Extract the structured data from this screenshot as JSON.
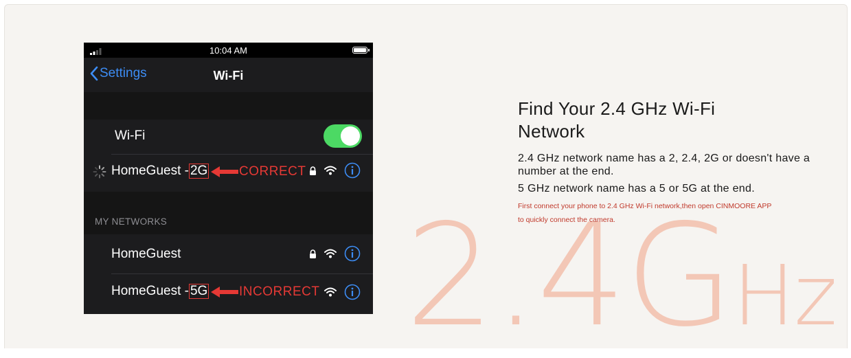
{
  "watermark": {
    "main": "2.4G",
    "unit": "Hz",
    "color": "#f3c7b6"
  },
  "phone": {
    "status": {
      "time": "10:04 AM"
    },
    "nav": {
      "back_label": "Settings",
      "title": "Wi-Fi"
    },
    "wifi_row": {
      "label": "Wi-Fi",
      "toggle_on": true
    },
    "current_network": {
      "name_prefix": "HomeGuest -",
      "name_suffix": "2G",
      "flag": "CORRECT"
    },
    "section_header": "MY NETWORKS",
    "networks": [
      {
        "name": "HomeGuest"
      },
      {
        "name_prefix": "HomeGuest -",
        "name_suffix": "5G",
        "flag": "INCORRECT"
      }
    ],
    "colors": {
      "accent": "#3d8df5",
      "toggle": "#4cd964",
      "highlight": "#e53935"
    }
  },
  "content": {
    "heading_line1": "Find Your 2.4 GHz Wi-Fi",
    "heading_line2": "Network",
    "p1": "2.4 GHz network name has a 2, 2.4, 2G or doesn't have a number at the end.",
    "p2": "5 GHz network name has a 5 or 5G at the end.",
    "note_line1": "First connect your phone to 2.4 GHz Wi-Fi network,then open CINMOORE APP",
    "note_line2": "to quickly connect the camera."
  },
  "icons": [
    "signal-icon",
    "battery-icon",
    "chevron-left-icon",
    "spinner-icon",
    "lock-icon",
    "wifi-icon",
    "info-icon",
    "arrow-left-icon"
  ]
}
